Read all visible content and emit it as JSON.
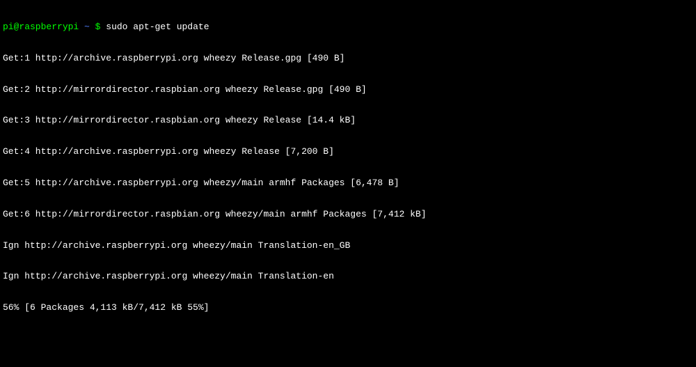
{
  "prompt": {
    "user_host": "pi@raspberrypi",
    "path": "~",
    "symbol": "$",
    "command": "sudo apt-get update"
  },
  "output": {
    "lines": [
      "Get:1 http://archive.raspberrypi.org wheezy Release.gpg [490 B]",
      "Get:2 http://mirrordirector.raspbian.org wheezy Release.gpg [490 B]",
      "Get:3 http://mirrordirector.raspbian.org wheezy Release [14.4 kB]",
      "Get:4 http://archive.raspberrypi.org wheezy Release [7,200 B]",
      "Get:5 http://archive.raspberrypi.org wheezy/main armhf Packages [6,478 B]",
      "Get:6 http://mirrordirector.raspbian.org wheezy/main armhf Packages [7,412 kB]",
      "Ign http://archive.raspberrypi.org wheezy/main Translation-en_GB",
      "Ign http://archive.raspberrypi.org wheezy/main Translation-en",
      "56% [6 Packages 4,113 kB/7,412 kB 55%]"
    ]
  }
}
